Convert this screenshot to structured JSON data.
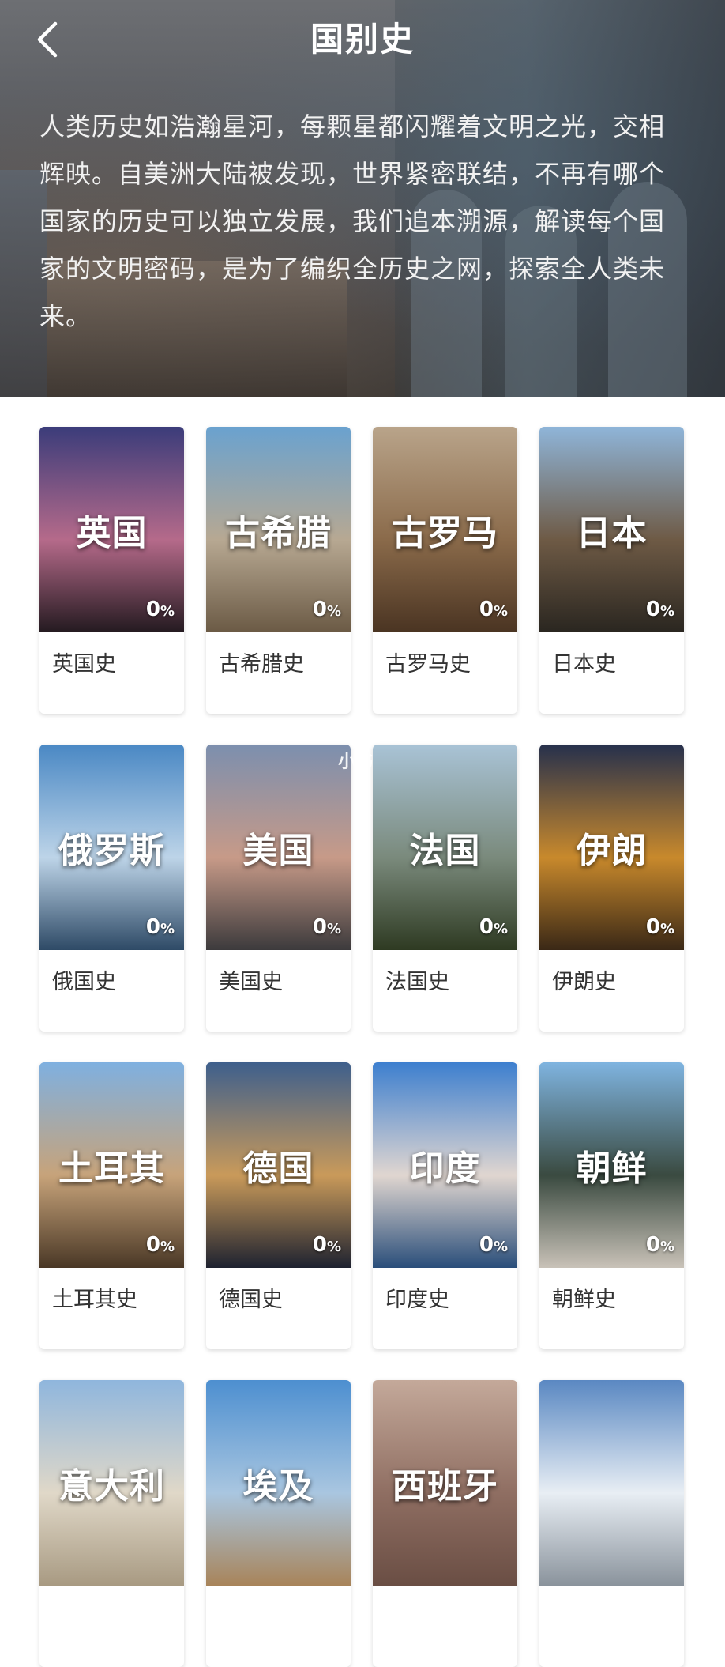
{
  "header": {
    "title": "国别史",
    "back_icon": "chevron-left-icon"
  },
  "intro": "人类历史如浩瀚星河，每颗星都闪耀着文明之光，交相辉映。自美洲大陆被发现，世界紧密联结，不再有哪个国家的历史可以独立发展，我们追本溯源，解读每个国家的文明密码，是为了编织全历史之网，探索全人类未来。",
  "watermark": "小书",
  "cards": [
    {
      "image_label": "英国",
      "progress": "0",
      "progress_unit": "%",
      "name": "英国史",
      "colors": [
        "#3b3c7a",
        "#b56a8a",
        "#241a20"
      ]
    },
    {
      "image_label": "古希腊",
      "progress": "0",
      "progress_unit": "%",
      "name": "古希腊史",
      "colors": [
        "#6aa2cf",
        "#b7a892",
        "#6b5a45"
      ]
    },
    {
      "image_label": "古罗马",
      "progress": "0",
      "progress_unit": "%",
      "name": "古罗马史",
      "colors": [
        "#b9a48a",
        "#8a6a4a",
        "#4a3422"
      ]
    },
    {
      "image_label": "日本",
      "progress": "0",
      "progress_unit": "%",
      "name": "日本史",
      "colors": [
        "#8fb5d9",
        "#6e5a45",
        "#2a2620"
      ]
    },
    {
      "image_label": "俄罗斯",
      "progress": "0",
      "progress_unit": "%",
      "name": "俄国史",
      "colors": [
        "#4a88c4",
        "#bdd4e8",
        "#2e4a66"
      ]
    },
    {
      "image_label": "美国",
      "progress": "0",
      "progress_unit": "%",
      "name": "美国史",
      "colors": [
        "#7c8fae",
        "#c79a88",
        "#3c3a3c"
      ]
    },
    {
      "image_label": "法国",
      "progress": "0",
      "progress_unit": "%",
      "name": "法国史",
      "colors": [
        "#a9c3d6",
        "#7a8a7c",
        "#2e3a22"
      ]
    },
    {
      "image_label": "伊朗",
      "progress": "0",
      "progress_unit": "%",
      "name": "伊朗史",
      "colors": [
        "#26304c",
        "#c8892c",
        "#3a2816"
      ]
    },
    {
      "image_label": "土耳其",
      "progress": "0",
      "progress_unit": "%",
      "name": "土耳其史",
      "colors": [
        "#7fb0e0",
        "#c7a37a",
        "#4a3826"
      ]
    },
    {
      "image_label": "德国",
      "progress": "0",
      "progress_unit": "%",
      "name": "德国史",
      "colors": [
        "#3e5f8c",
        "#c99a5a",
        "#1e2230"
      ]
    },
    {
      "image_label": "印度",
      "progress": "0",
      "progress_unit": "%",
      "name": "印度史",
      "colors": [
        "#3d7fcf",
        "#e0d6d0",
        "#2a4e7a"
      ]
    },
    {
      "image_label": "朝鲜",
      "progress": "0",
      "progress_unit": "%",
      "name": "朝鲜史",
      "colors": [
        "#7fb4e0",
        "#3a4a40",
        "#c9c2b8"
      ]
    },
    {
      "image_label": "意大利",
      "progress": "",
      "progress_unit": "",
      "name": "",
      "colors": [
        "#8fb6dd",
        "#e0d8c8",
        "#a89a82"
      ]
    },
    {
      "image_label": "埃及",
      "progress": "",
      "progress_unit": "",
      "name": "",
      "colors": [
        "#4d8fd0",
        "#a9c6e0",
        "#a8845a"
      ]
    },
    {
      "image_label": "西班牙",
      "progress": "",
      "progress_unit": "",
      "name": "",
      "colors": [
        "#c4a99a",
        "#8f6e62",
        "#6a4e44"
      ]
    },
    {
      "image_label": "",
      "progress": "",
      "progress_unit": "",
      "name": "",
      "colors": [
        "#5a88c2",
        "#e8eef4",
        "#8a939c"
      ]
    }
  ]
}
